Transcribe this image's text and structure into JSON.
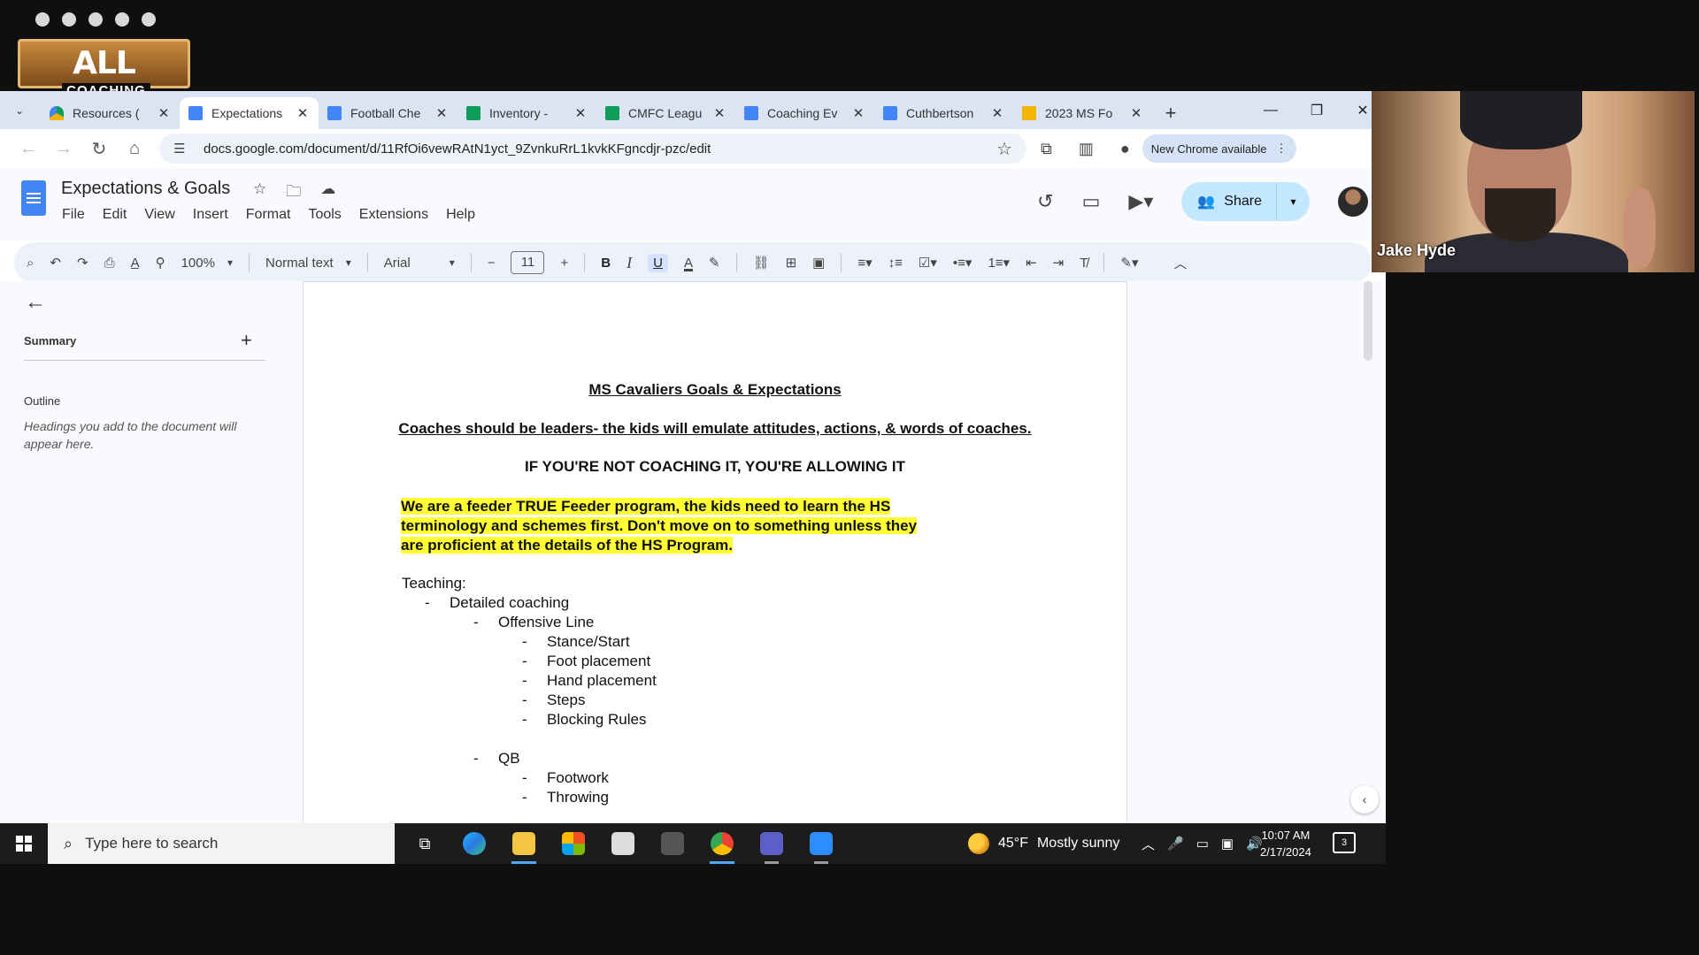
{
  "logo": {
    "text": "ALL ACCESS",
    "sub": "COACHING"
  },
  "browser": {
    "tabs": [
      {
        "label": "Resources (",
        "type": "drive",
        "active": false
      },
      {
        "label": "Expectations",
        "type": "doc",
        "active": true
      },
      {
        "label": "Football Che",
        "type": "doc",
        "active": false
      },
      {
        "label": "Inventory - ",
        "type": "sheet",
        "active": false
      },
      {
        "label": "CMFC Leagu",
        "type": "sheet",
        "active": false
      },
      {
        "label": "Coaching Ev",
        "type": "doc",
        "active": false
      },
      {
        "label": "Cuthbertson",
        "type": "doc",
        "active": false
      },
      {
        "label": "2023 MS Fo",
        "type": "slide",
        "active": false
      }
    ],
    "url": "docs.google.com/document/d/11RfOi6vewRAtN1yct_9ZvnkuRrL1kvkKFgncdjr-pzc/edit",
    "new_chrome": "New Chrome available"
  },
  "docs": {
    "title": "Expectations & Goals",
    "menu": [
      "File",
      "Edit",
      "View",
      "Insert",
      "Format",
      "Tools",
      "Extensions",
      "Help"
    ],
    "share_label": "Share",
    "toolbar": {
      "zoom": "100%",
      "style": "Normal text",
      "font": "Arial",
      "font_size": "11"
    }
  },
  "sidebar": {
    "summary_label": "Summary",
    "outline_label": "Outline",
    "outline_hint": "Headings you add to the document will appear here."
  },
  "document": {
    "title": "MS Cavaliers Goals & Expectations",
    "lead": "Coaches should be leaders- the kids will emulate attitudes, actions, & words of coaches.",
    "caps": "IF YOU'RE NOT COACHING IT, YOU'RE ALLOWING IT",
    "highlight": "We are a feeder TRUE Feeder program, the kids need to learn the HS terminology and schemes first. Don't move on to something unless they are proficient at the details of the HS Program.",
    "lines": [
      {
        "level": 0,
        "text": "Teaching:"
      },
      {
        "level": 1,
        "text": "Detailed coaching"
      },
      {
        "level": 2,
        "text": "Offensive Line"
      },
      {
        "level": 3,
        "text": "Stance/Start"
      },
      {
        "level": 3,
        "text": "Foot placement"
      },
      {
        "level": 3,
        "text": "Hand placement"
      },
      {
        "level": 3,
        "text": "Steps"
      },
      {
        "level": 3,
        "text": "Blocking Rules"
      },
      {
        "level": -1,
        "text": ""
      },
      {
        "level": 2,
        "text": "QB"
      },
      {
        "level": 3,
        "text": "Footwork"
      },
      {
        "level": 3,
        "text": "Throwing"
      }
    ]
  },
  "taskbar": {
    "search_placeholder": "Type here to search",
    "temperature": "45°F",
    "weather": "Mostly sunny",
    "time": "10:07 AM",
    "date": "2/17/2024",
    "notifications": "3"
  },
  "video": {
    "name": "Jake Hyde"
  }
}
